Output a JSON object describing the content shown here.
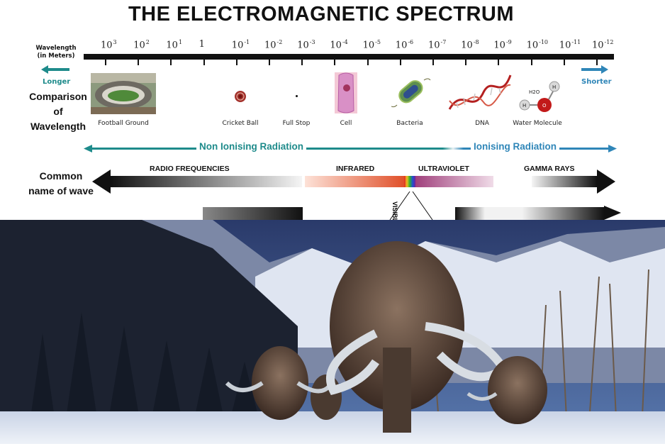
{
  "title": "THE ELECTROMAGNETIC SPECTRUM",
  "wavelength_label": [
    "Wavelength",
    "(in Meters)"
  ],
  "scale": {
    "powers": [
      {
        "base": "10",
        "exp": "3"
      },
      {
        "base": "10",
        "exp": "2"
      },
      {
        "base": "10",
        "exp": "1"
      },
      {
        "base": "1",
        "exp": ""
      },
      {
        "base": "10",
        "exp": "-1"
      },
      {
        "base": "10",
        "exp": "-2"
      },
      {
        "base": "10",
        "exp": "-3"
      },
      {
        "base": "10",
        "exp": "-4"
      },
      {
        "base": "10",
        "exp": "-5"
      },
      {
        "base": "10",
        "exp": "-6"
      },
      {
        "base": "10",
        "exp": "-7"
      },
      {
        "base": "10",
        "exp": "-8"
      },
      {
        "base": "10",
        "exp": "-9"
      },
      {
        "base": "10",
        "exp": "-10"
      },
      {
        "base": "10",
        "exp": "-11"
      },
      {
        "base": "10",
        "exp": "-12"
      }
    ]
  },
  "longer": "Longer",
  "shorter": "Shorter",
  "comparison_label": [
    "Comparison",
    "of",
    "Wavelength"
  ],
  "objects": [
    "Football Ground",
    "Cricket Ball",
    "Full Stop",
    "Cell",
    "Bacteria",
    "DNA",
    "Water Molecule"
  ],
  "molecule_labels": {
    "h2o": "H2O",
    "h": "H",
    "o": "O"
  },
  "non_ionising": "Non Ionising Radiation",
  "ionising": "Ionising Radiation",
  "common_name_label": [
    "Common",
    "name of wave"
  ],
  "bands": {
    "radio": "RADIO FREQUENCIES",
    "infrared": "INFRARED",
    "ultraviolet": "ULTRAVIOLET",
    "gamma": "GAMMA RAYS",
    "visible": "VISIBLE"
  },
  "colors": {
    "teal": "#1e8b8b",
    "blue": "#2f86b8",
    "dark": "#111111"
  }
}
